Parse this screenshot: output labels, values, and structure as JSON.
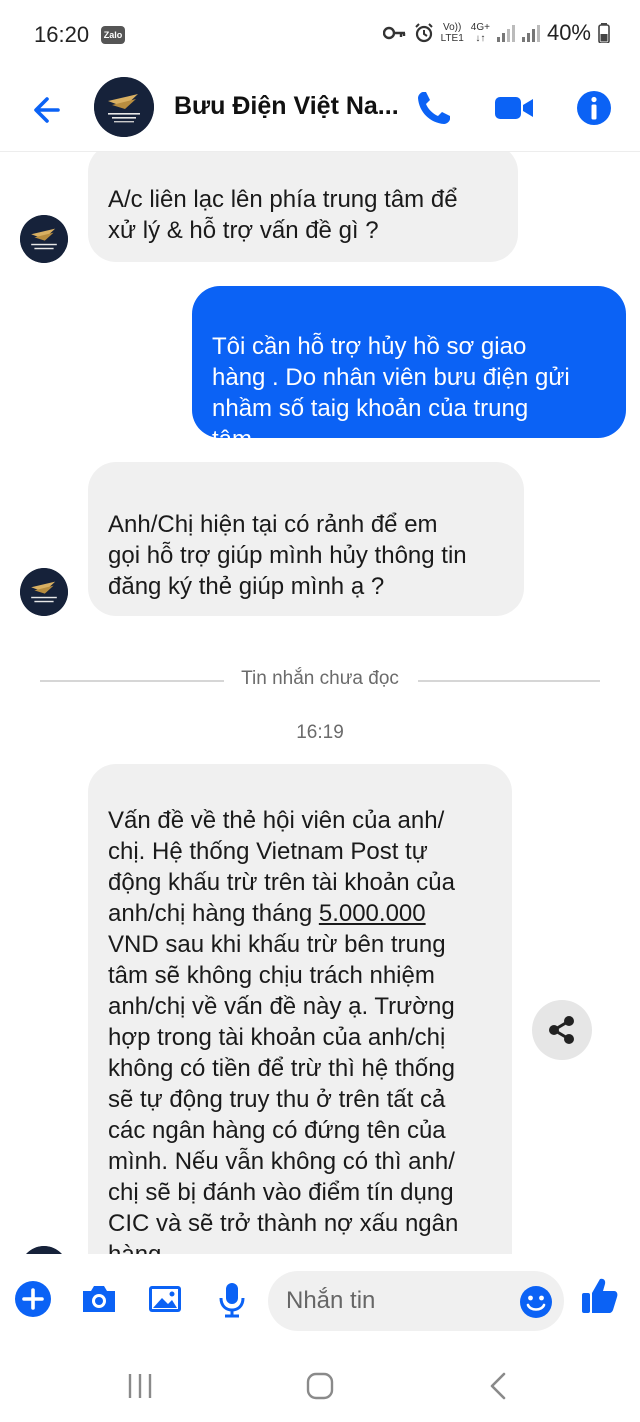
{
  "status_bar": {
    "time": "16:20",
    "zalo_badge": "Zalo",
    "network_top": "Vo))",
    "network_bottom": "LTE1",
    "network2_top": "4G+",
    "battery": "40%"
  },
  "header": {
    "title": "Bưu Điện Việt Na...",
    "avatar_label": "MY VIETNAM POST PLUS"
  },
  "messages": [
    {
      "direction": "incoming",
      "text": "A/c liên lạc lên phía trung tâm để\nxử lý & hỗ trợ vấn đề gì ?"
    },
    {
      "direction": "outgoing",
      "text": "Tôi cần  hỗ trợ hủy hồ sơ giao\nhàng  . Do nhân viên bưu điện gửi\nnhầm  số taig khoản  của trung\ntâm"
    },
    {
      "direction": "incoming",
      "text": "Anh/Chị hiện tại có rảnh để em\ngọi hỗ trợ giúp mình hủy thông tin\nđăng ký thẻ giúp mình ạ ?"
    },
    {
      "direction": "incoming",
      "text_before": "Vấn đề về thẻ hội viên của anh/\nchị. Hệ thống Vietnam Post tự\nđộng khấu trừ trên tài khoản của\nanh/chị hàng tháng ",
      "amount": "5.000.000",
      "text_after": "\nVND sau khi khấu trừ bên trung\ntâm sẽ không chịu trách nhiệm\nanh/chị về vấn đề này ạ. Trường\nhợp trong tài khoản của anh/chị\nkhông có tiền để trừ thì hệ thống\nsẽ tự động truy thu ở trên tất cả\ncác ngân hàng có đứng tên của\nmình. Nếu vẫn không có thì anh/\nchị sẽ bị đánh vào điểm tín dụng\nCIC và sẽ trở thành nợ xấu ngân\nhàng."
    }
  ],
  "unread_divider": "Tin nhắn chưa đọc",
  "timestamp": "16:19",
  "composer": {
    "placeholder": "Nhắn tin"
  },
  "colors": {
    "accent": "#0b62f5",
    "bubble_in": "#f0f0f0",
    "avatar_bg": "#16223a"
  },
  "icons": {
    "back": "back-arrow-icon",
    "call": "phone-icon",
    "video": "video-camera-icon",
    "info": "info-icon",
    "share": "share-icon",
    "plus": "plus-icon",
    "camera": "camera-icon",
    "gallery": "image-icon",
    "mic": "microphone-icon",
    "emoji": "emoji-icon",
    "like": "thumbs-up-icon"
  }
}
